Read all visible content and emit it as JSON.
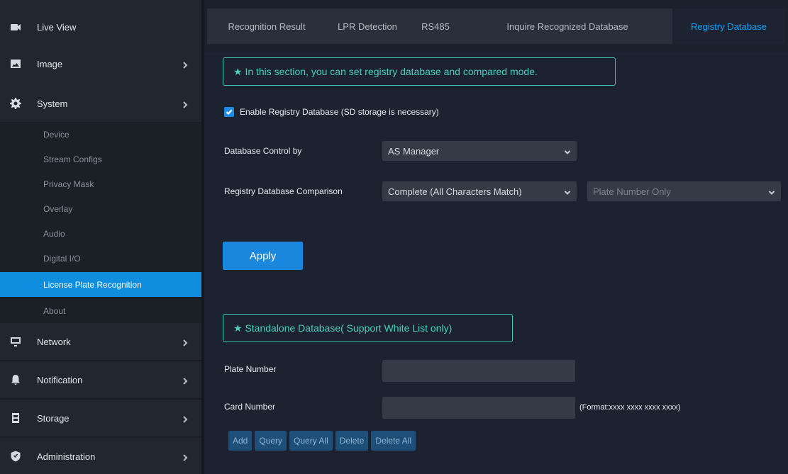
{
  "sidebar": {
    "items": [
      {
        "label": "Live View",
        "icon": "live-view-icon"
      },
      {
        "label": "Image",
        "icon": "image-icon"
      },
      {
        "label": "System",
        "icon": "gear-icon"
      },
      {
        "label": "Network",
        "icon": "monitor-icon"
      },
      {
        "label": "Notification",
        "icon": "bell-icon"
      },
      {
        "label": "Storage",
        "icon": "storage-icon"
      },
      {
        "label": "Administration",
        "icon": "shield-icon"
      }
    ],
    "system_sub": [
      {
        "label": "Device"
      },
      {
        "label": "Stream Configs"
      },
      {
        "label": "Privacy Mask"
      },
      {
        "label": "Overlay"
      },
      {
        "label": "Audio"
      },
      {
        "label": "Digital I/O"
      },
      {
        "label": "License Plate Recognition",
        "active": true
      },
      {
        "label": "About"
      }
    ]
  },
  "tabs": [
    {
      "label": "Recognition Result"
    },
    {
      "label": "LPR Detection"
    },
    {
      "label": "RS485"
    },
    {
      "label": "Inquire Recognized Database"
    },
    {
      "label": "Registry Database",
      "active": true
    }
  ],
  "registry": {
    "notice": "★ In this section, you can set registry database and compared mode.",
    "enable_label": "Enable Registry Database (SD storage is necessary)",
    "enable_checked": true,
    "control_label": "Database Control by",
    "control_value": "AS Manager",
    "comparison_label": "Registry Database Comparison",
    "comparison_value": "Complete (All Characters Match)",
    "comparison_scope_value": "Plate Number Only",
    "apply_label": "Apply"
  },
  "standalone": {
    "notice": "★ Standalone Database( Support White List only)",
    "plate_label": "Plate Number",
    "plate_value": "",
    "card_label": "Card Number",
    "card_value": "",
    "card_format_hint": "(Format:xxxx xxxx xxxx xxxx)",
    "buttons": {
      "add": "Add",
      "query": "Query",
      "query_all": "Query All",
      "delete": "Delete",
      "delete_all": "Delete All"
    }
  },
  "colors": {
    "accent": "#0f8ee0",
    "notice": "#4ad0c1",
    "tab_active": "#10a2f5",
    "button_dim": "#1e4f78"
  }
}
